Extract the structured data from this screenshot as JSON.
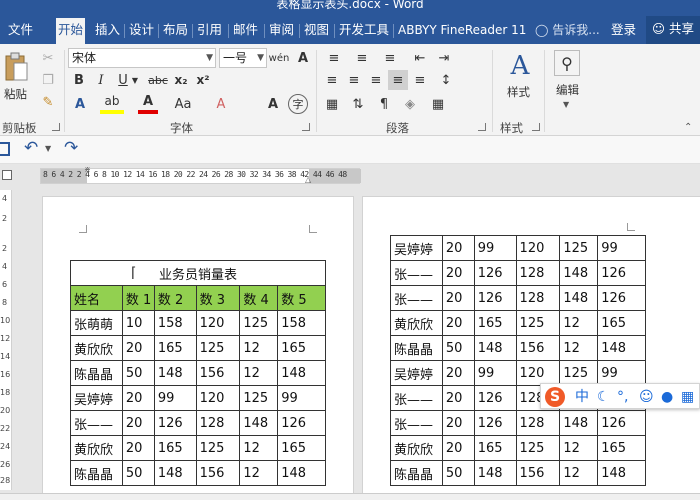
{
  "window": {
    "title": "表格显示表头.docx - Word"
  },
  "tabs": [
    {
      "label": "文件"
    },
    {
      "label": "开始"
    },
    {
      "label": "插入"
    },
    {
      "label": "设计"
    },
    {
      "label": "布局"
    },
    {
      "label": "引用"
    },
    {
      "label": "邮件"
    },
    {
      "label": "审阅"
    },
    {
      "label": "视图"
    },
    {
      "label": "开发工具"
    },
    {
      "label": "ABBYY FineReader 11"
    }
  ],
  "tell_me": "告诉我...",
  "login": "登录",
  "share": "共享",
  "ribbon": {
    "clipboard": {
      "paste": "粘贴",
      "label": "剪贴板"
    },
    "font": {
      "name": "宋体",
      "size": "一号",
      "label": "字体"
    },
    "paragraph": {
      "label": "段落"
    },
    "styles": {
      "button": "样式",
      "label": "样式"
    },
    "editing": {
      "button": "编辑"
    }
  },
  "ruler": {
    "text": "8 6 4 2   2  4  6  8 10 12 14 16 18 20 22 24 26 28 30 32 34 36 38    42 44 46 48"
  },
  "vruler": [
    "4",
    "2",
    "2",
    "4",
    "6",
    "8",
    "10",
    "12",
    "14",
    "16",
    "18",
    "20",
    "22",
    "24",
    "26",
    "28",
    "30"
  ],
  "table1": {
    "title": "业务员销量表",
    "headers": [
      "姓名",
      "数 1",
      "数 2",
      "数 3",
      "数 4",
      "数 5"
    ],
    "rows": [
      [
        "张萌萌",
        "10",
        "158",
        "120",
        "125",
        "158"
      ],
      [
        "黄欣欣",
        "20",
        "165",
        "125",
        "12",
        "165"
      ],
      [
        "陈晶晶",
        "50",
        "148",
        "156",
        "12",
        "148"
      ],
      [
        "吴婷婷",
        "20",
        "99",
        "120",
        "125",
        "99"
      ],
      [
        "张——",
        "20",
        "126",
        "128",
        "148",
        "126"
      ],
      [
        "黄欣欣",
        "20",
        "165",
        "125",
        "12",
        "165"
      ],
      [
        "陈晶晶",
        "50",
        "148",
        "156",
        "12",
        "148"
      ]
    ]
  },
  "table2": {
    "rows": [
      [
        "吴婷婷",
        "20",
        "99",
        "120",
        "125",
        "99"
      ],
      [
        "张——",
        "20",
        "126",
        "128",
        "148",
        "126"
      ],
      [
        "张——",
        "20",
        "126",
        "128",
        "148",
        "126"
      ],
      [
        "黄欣欣",
        "20",
        "165",
        "125",
        "12",
        "165"
      ],
      [
        "陈晶晶",
        "50",
        "148",
        "156",
        "12",
        "148"
      ],
      [
        "吴婷婷",
        "20",
        "99",
        "120",
        "125",
        "99"
      ],
      [
        "张——",
        "20",
        "126",
        "128",
        "148",
        "126"
      ],
      [
        "张——",
        "20",
        "126",
        "128",
        "148",
        "126"
      ],
      [
        "黄欣欣",
        "20",
        "165",
        "125",
        "12",
        "165"
      ],
      [
        "陈晶晶",
        "50",
        "148",
        "156",
        "12",
        "148"
      ]
    ]
  },
  "ime": {
    "logo": "S",
    "mode": "中"
  },
  "colors": {
    "word_blue": "#2b579a",
    "header_green": "#92d050"
  }
}
